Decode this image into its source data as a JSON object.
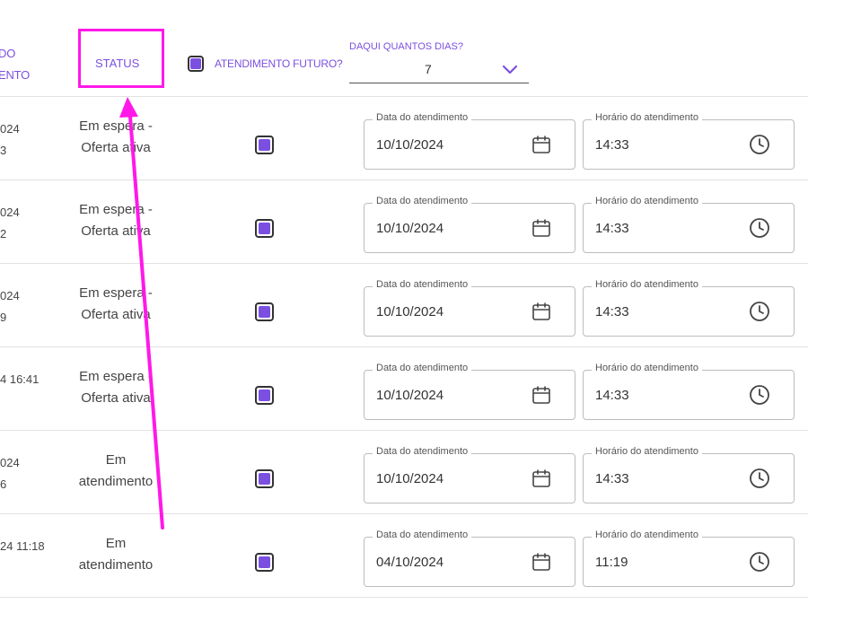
{
  "header": {
    "col0_line1": "DO",
    "col0_line2": "ENTO",
    "status": "STATUS",
    "future_label": "ATENDIMENTO FUTURO?",
    "days_label": "DAQUI QUANTOS DIAS?",
    "days_value": "7"
  },
  "field_labels": {
    "date": "Data do atendimento",
    "time": "Horário do atendimento"
  },
  "rows": [
    {
      "date_line1": "024",
      "date_line2": "3",
      "status_line1": "Em espera -",
      "status_line2": "Oferta ativa",
      "future_checked": true,
      "date": "10/10/2024",
      "time": "14:33"
    },
    {
      "date_line1": "024",
      "date_line2": "2",
      "status_line1": "Em espera -",
      "status_line2": "Oferta ativa",
      "future_checked": true,
      "date": "10/10/2024",
      "time": "14:33"
    },
    {
      "date_line1": "024",
      "date_line2": "9",
      "status_line1": "Em espera -",
      "status_line2": "Oferta ativa",
      "future_checked": true,
      "date": "10/10/2024",
      "time": "14:33"
    },
    {
      "date_line1": "4 16:41",
      "date_line2": "",
      "status_line1": "Em espera -",
      "status_line2": "Oferta ativa",
      "future_checked": true,
      "date": "10/10/2024",
      "time": "14:33"
    },
    {
      "date_line1": "024",
      "date_line2": "6",
      "status_line1": "Em",
      "status_line2": "atendimento",
      "future_checked": true,
      "date": "10/10/2024",
      "time": "14:33"
    },
    {
      "date_line1": "24 11:18",
      "date_line2": "",
      "status_line1": "Em",
      "status_line2": "atendimento",
      "future_checked": true,
      "date": "04/10/2024",
      "time": "11:19"
    }
  ],
  "colors": {
    "accent": "#7b4fe0",
    "highlight": "#ff18e8"
  }
}
